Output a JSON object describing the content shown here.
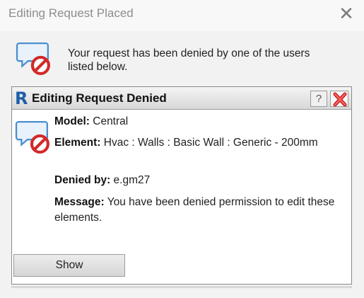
{
  "outer_dialog": {
    "title": "Editing Request Placed",
    "close_glyph": "✕",
    "message": "Your request has been denied by one of the users listed below.",
    "icon": "denied-comment-icon"
  },
  "inner_dialog": {
    "title": "Editing Request Denied",
    "app_logo": "R",
    "help_glyph": "?",
    "close_icon": "red-x-close-icon",
    "model_label": "Model:",
    "model_value": "Central",
    "element_label": "Element:",
    "element_value": "Hvac : Walls : Basic Wall : Generic - 200mm",
    "denied_by_label": "Denied by:",
    "denied_by_value": "e.gm27",
    "message_label": "Message:",
    "message_value": "You have been denied permission to edit these elements.",
    "show_button": "Show"
  },
  "colors": {
    "bubble_blue": "#4a8fd0",
    "denied_red": "#d12a2a",
    "logo_blue": "#1f5fa8",
    "outer_background": "#f2f2f2"
  }
}
